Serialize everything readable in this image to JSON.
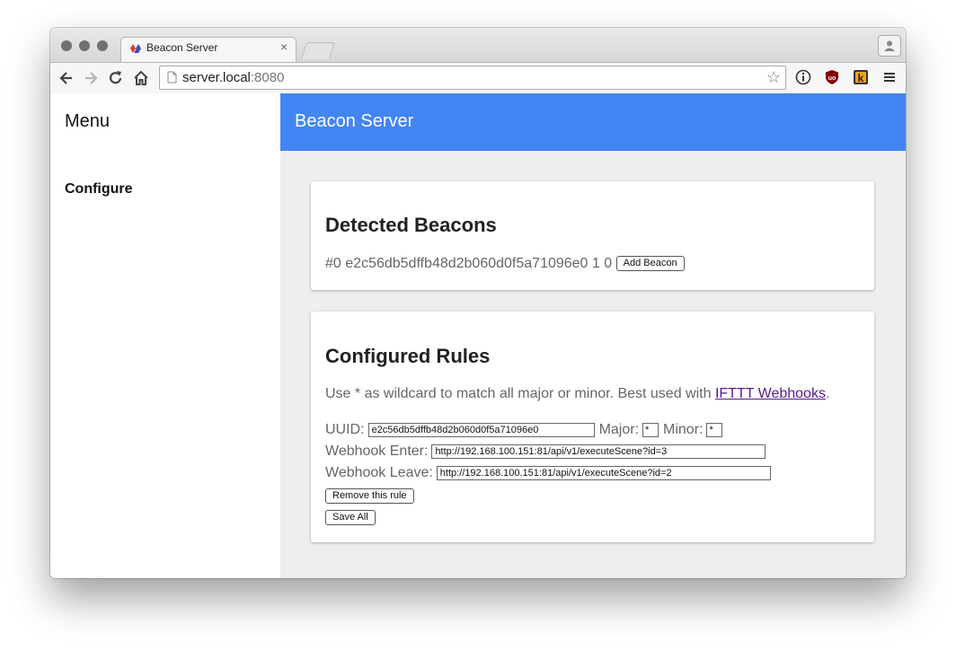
{
  "browser": {
    "tab_title": "Beacon Server",
    "tab_close": "×",
    "url_host": "server.local",
    "url_port": ":8080"
  },
  "sidebar": {
    "title": "Menu",
    "items": [
      {
        "label": "Configure"
      }
    ]
  },
  "app": {
    "title": "Beacon Server"
  },
  "detected": {
    "heading": "Detected Beacons",
    "beacons": [
      {
        "index": "#0",
        "uuid": "e2c56db5dffb48d2b060d0f5a71096e0",
        "major": "1",
        "minor": "0",
        "add_label": "Add Beacon"
      }
    ]
  },
  "rules": {
    "heading": "Configured Rules",
    "hint_prefix": "Use * as wildcard to match all major or minor. Best used with ",
    "hint_link": "IFTTT Webhooks",
    "hint_suffix": ".",
    "uuid_label": "UUID:",
    "uuid_value": "e2c56db5dffb48d2b060d0f5a71096e0",
    "major_label": "Major:",
    "major_value": "*",
    "minor_label": "Minor:",
    "minor_value": "*",
    "enter_label": "Webhook Enter:",
    "enter_value": "http://192.168.100.151:81/api/v1/executeScene?id=3",
    "leave_label": "Webhook Leave:",
    "leave_value": "http://192.168.100.151:81/api/v1/executeScene?id=2",
    "remove_label": "Remove this rule",
    "save_label": "Save All"
  }
}
